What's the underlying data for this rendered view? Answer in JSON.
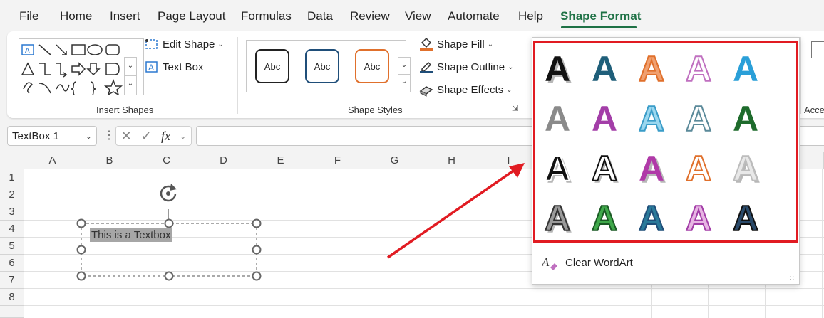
{
  "menu": {
    "tabs": [
      {
        "label": "File"
      },
      {
        "label": "Home"
      },
      {
        "label": "Insert"
      },
      {
        "label": "Page Layout"
      },
      {
        "label": "Formulas"
      },
      {
        "label": "Data"
      },
      {
        "label": "Review"
      },
      {
        "label": "View"
      },
      {
        "label": "Automate"
      },
      {
        "label": "Help"
      },
      {
        "label": "Shape Format"
      }
    ]
  },
  "ribbon": {
    "insert_shapes": {
      "label": "Insert Shapes",
      "edit_shape": "Edit Shape",
      "text_box": "Text Box"
    },
    "shape_styles": {
      "label": "Shape Styles",
      "presets": [
        {
          "text": "Abc",
          "color": "#222222"
        },
        {
          "text": "Abc",
          "color": "#1f4e79"
        },
        {
          "text": "Abc",
          "color": "#e0702c"
        }
      ],
      "fill": "Shape Fill",
      "outline": "Shape Outline",
      "effects": "Shape Effects"
    },
    "accessibility_label": "Acce"
  },
  "formula_bar": {
    "name_box": "TextBox 1",
    "fx": "fx",
    "value": ""
  },
  "sheet": {
    "columns": [
      "A",
      "B",
      "C",
      "D",
      "E",
      "F",
      "G",
      "H",
      "I"
    ],
    "rows": [
      "1",
      "2",
      "3",
      "4",
      "5",
      "6",
      "7",
      "8"
    ],
    "textbox_text": "This is a Textbox"
  },
  "wordart": {
    "styles": [
      {
        "glyph": "A",
        "fill": "#111111",
        "stroke": "none",
        "shadow": true
      },
      {
        "glyph": "A",
        "fill": "#1f5f7a",
        "stroke": "none",
        "shadow": false
      },
      {
        "glyph": "A",
        "fill": "#f0a070",
        "stroke": "#e0702c",
        "shadow": false
      },
      {
        "glyph": "A",
        "fill": "#ffffff",
        "stroke": "#c070c0",
        "shadow": false
      },
      {
        "glyph": "A",
        "fill": "#2a9fd8",
        "stroke": "none",
        "shadow": false
      },
      {
        "glyph": "A",
        "fill": "#8a8a8a",
        "stroke": "none",
        "shadow": false
      },
      {
        "glyph": "A",
        "fill": "#a33ea8",
        "stroke": "none",
        "shadow": false
      },
      {
        "glyph": "A",
        "fill": "#9ad7ef",
        "stroke": "#3a9cc8",
        "shadow": false
      },
      {
        "glyph": "A",
        "fill": "#ffffff",
        "stroke": "#5b8a9a",
        "shadow": false
      },
      {
        "glyph": "A",
        "fill": "#1e6b2c",
        "stroke": "none",
        "shadow": false
      },
      {
        "glyph": "A",
        "fill": "#111111",
        "stroke": "#ffffff",
        "shadow": true
      },
      {
        "glyph": "A",
        "fill": "#ffffff",
        "stroke": "#111111",
        "shadow": true
      },
      {
        "glyph": "A",
        "fill": "#b03aa8",
        "stroke": "none",
        "shadow": true
      },
      {
        "glyph": "A",
        "fill": "#ffffff",
        "stroke": "#e0702c",
        "shadow": false
      },
      {
        "glyph": "A",
        "fill": "#e8e8e8",
        "stroke": "#bdbdbd",
        "shadow": true
      },
      {
        "glyph": "A",
        "fill": "#9a9a9a",
        "stroke": "#333333",
        "shadow": true
      },
      {
        "glyph": "A",
        "fill": "#3fa84a",
        "stroke": "#1a5a24",
        "shadow": false
      },
      {
        "glyph": "A",
        "fill": "#2a7a9a",
        "stroke": "#1f4e79",
        "shadow": false
      },
      {
        "glyph": "A",
        "fill": "#e7b5e3",
        "stroke": "#a33ea8",
        "shadow": false
      },
      {
        "glyph": "A",
        "fill": "#2a4a6a",
        "stroke": "#111111",
        "shadow": false
      }
    ],
    "clear_label": "Clear WordArt"
  },
  "colors": {
    "accent": "#1e7145",
    "highlight": "#e11b22",
    "arrow": "#e11b22"
  }
}
